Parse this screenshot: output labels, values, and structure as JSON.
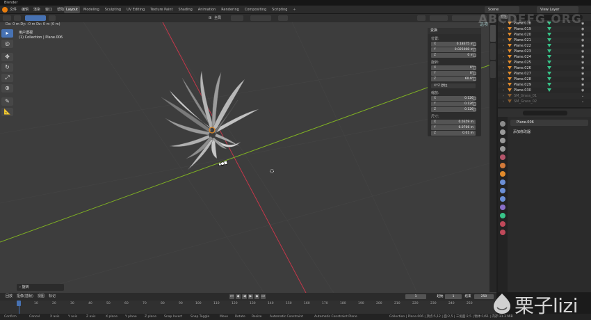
{
  "app": {
    "title": "Blender"
  },
  "menu": [
    "文件",
    "编辑",
    "渲染",
    "窗口",
    "帮助"
  ],
  "workspace_tabs": [
    {
      "label": "Layout",
      "active": true
    },
    {
      "label": "Modeling"
    },
    {
      "label": "Sculpting"
    },
    {
      "label": "UV Editing"
    },
    {
      "label": "Texture Paint"
    },
    {
      "label": "Shading"
    },
    {
      "label": "Animation"
    },
    {
      "label": "Rendering"
    },
    {
      "label": "Compositing"
    },
    {
      "label": "Scripting"
    }
  ],
  "add_workspace": "+",
  "scene": {
    "label": "Scene"
  },
  "view_layer": {
    "label": "View Layer"
  },
  "viewport_header": {
    "orientation": "全局"
  },
  "viewport": {
    "coords": "Dx: 0 m  Dy: -0 m  Dz: 0 m (0 m)",
    "view_name": "用户透视",
    "collection": "(1) Collection | Plane.006",
    "gizmo": [
      "选项",
      "⌄"
    ]
  },
  "toolbar_tools": [
    {
      "name": "select-box",
      "glyph": "▸",
      "active": true
    },
    {
      "name": "cursor",
      "glyph": "◎"
    },
    {
      "name": "move",
      "glyph": "✥"
    },
    {
      "name": "rotate",
      "glyph": "↻"
    },
    {
      "name": "scale",
      "glyph": "⤢"
    },
    {
      "name": "transform",
      "glyph": "⊕"
    },
    {
      "name": "annotate",
      "glyph": "✎"
    },
    {
      "name": "measure",
      "glyph": "📐"
    }
  ],
  "op_panel": "› 旋转",
  "n_panel": {
    "title": "变换",
    "location_label": "位置:",
    "location": [
      {
        "axis": "X",
        "value": "0.18375 m"
      },
      {
        "axis": "Y",
        "value": "0.025008 m"
      },
      {
        "axis": "Z",
        "value": "0 m"
      }
    ],
    "rotation_label": "旋转:",
    "rotation": [
      {
        "axis": "X",
        "value": "0°"
      },
      {
        "axis": "Y",
        "value": "0°"
      },
      {
        "axis": "Z",
        "value": "60.9°"
      }
    ],
    "rotation_mode": "XYZ 欧拉",
    "scale_label": "缩放:",
    "scale": [
      {
        "axis": "X",
        "value": "0.126"
      },
      {
        "axis": "Y",
        "value": "0.126"
      },
      {
        "axis": "Z",
        "value": "0.126"
      }
    ],
    "dimensions_label": "尺寸:",
    "dimensions": [
      {
        "axis": "X",
        "value": "0.0359 m"
      },
      {
        "axis": "Y",
        "value": "0.0706 m"
      },
      {
        "axis": "Z",
        "value": "0.01 m"
      }
    ]
  },
  "outliner": {
    "mode": "视图",
    "items": [
      {
        "name": "Plane.018"
      },
      {
        "name": "Plane.019"
      },
      {
        "name": "Plane.020"
      },
      {
        "name": "Plane.021"
      },
      {
        "name": "Plane.022"
      },
      {
        "name": "Plane.023"
      },
      {
        "name": "Plane.024"
      },
      {
        "name": "Plane.025"
      },
      {
        "name": "Plane.026"
      },
      {
        "name": "Plane.027"
      },
      {
        "name": "Plane.028"
      },
      {
        "name": "Plane.029"
      },
      {
        "name": "Plane.030"
      },
      {
        "name": "SM_Grass_01",
        "dim": true
      },
      {
        "name": "SM_Grass_02",
        "dim": true
      }
    ]
  },
  "properties": {
    "object": "Plane.006",
    "add_modifier": "添加修改器"
  },
  "timeline": {
    "menu": [
      "回放",
      "抠像(插帧)",
      "视图",
      "标记"
    ],
    "current_frame": "1",
    "start_label": "起始",
    "start": "1",
    "end_label": "结束",
    "end": "250",
    "ticks": [
      "0",
      "10",
      "20",
      "30",
      "40",
      "50",
      "60",
      "70",
      "80",
      "90",
      "100",
      "110",
      "120",
      "130",
      "140",
      "150",
      "160",
      "170",
      "180",
      "190",
      "200",
      "210",
      "220",
      "230",
      "240",
      "250"
    ]
  },
  "statusbar": {
    "items": [
      "Confirm",
      "Cancel",
      "X axis",
      "Y axis",
      "Z axis",
      "X plane",
      "Y plane",
      "Z plane",
      "Snap Invert",
      "Snap Toggle",
      "Move",
      "Rotate",
      "Resize",
      "Automatic Constraint",
      "Automatic Constraint Plane"
    ],
    "right": "Collection | Plane.006 | 顶点:5,12 | 面:2,5 | 三角面:2,5 | 物体:1/61 | 内存:31.3 MiB"
  },
  "watermark": {
    "text": "栗子lizi",
    "faint": "ABCDEFG.ORG"
  },
  "colors": {
    "accent": "#4772b3",
    "object_icon": "#e28b2b",
    "modifier_icon": "#38c58a",
    "x_axis": "#c6374a",
    "y_axis": "#7fb023"
  }
}
